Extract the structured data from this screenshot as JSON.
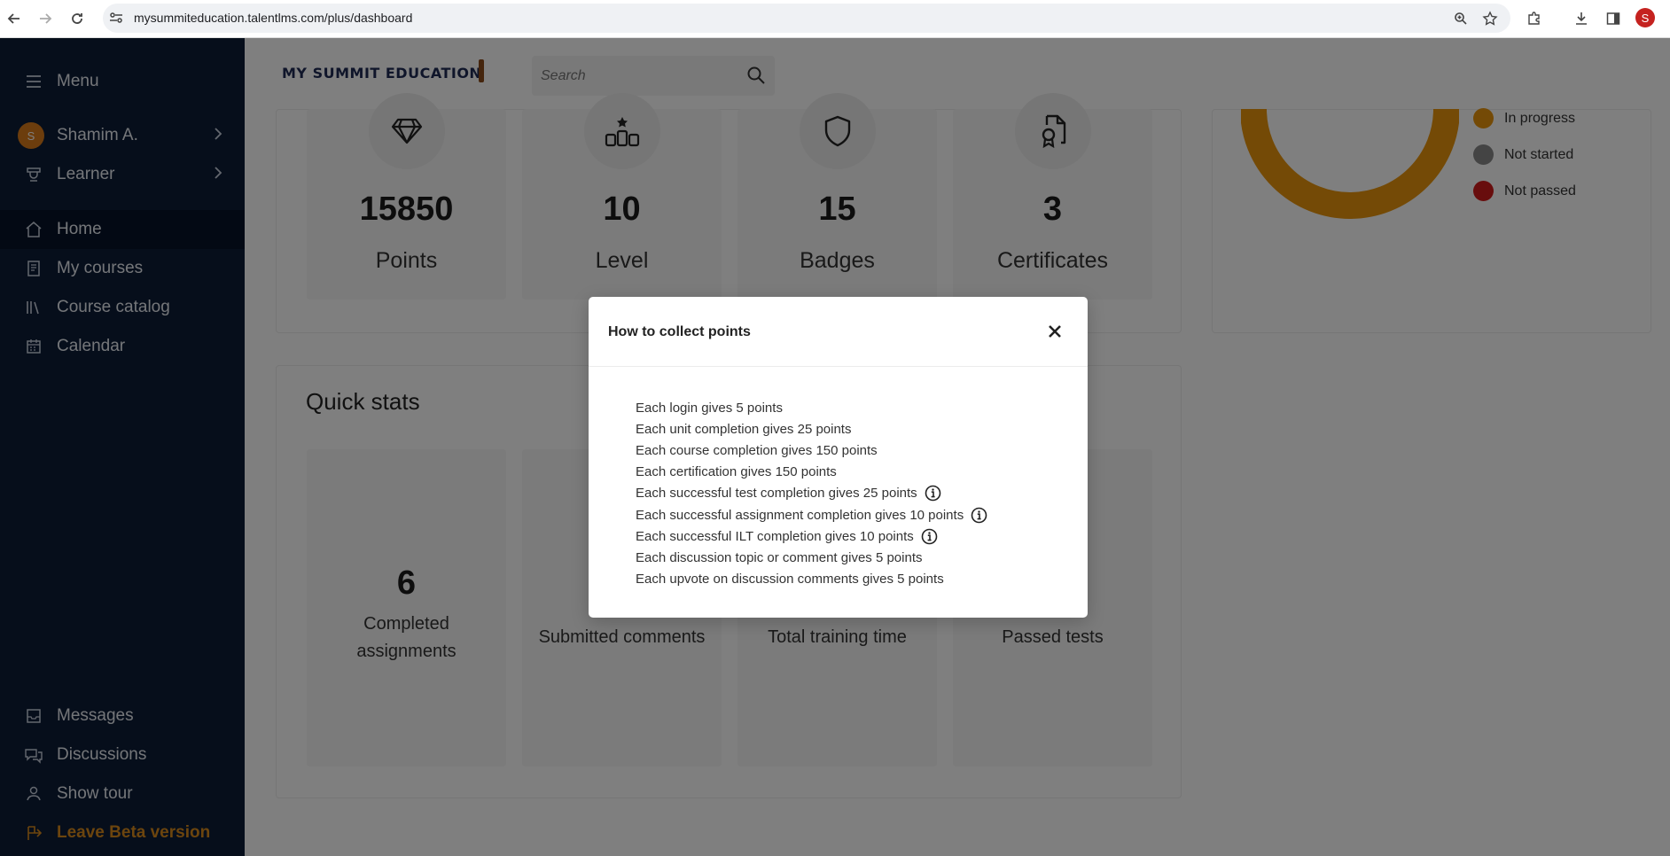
{
  "browser": {
    "url": "mysummiteducation.talentlms.com/plus/dashboard",
    "profile_initial": "S"
  },
  "sidebar": {
    "menu_label": "Menu",
    "user_name": "Shamim A.",
    "user_initial": "S",
    "role": "Learner",
    "items": [
      {
        "label": "Home",
        "icon": "home-icon"
      },
      {
        "label": "My courses",
        "icon": "book-icon"
      },
      {
        "label": "Course catalog",
        "icon": "catalog-icon"
      },
      {
        "label": "Calendar",
        "icon": "calendar-icon"
      }
    ],
    "bottom_items": [
      {
        "label": "Messages",
        "icon": "messages-icon"
      },
      {
        "label": "Discussions",
        "icon": "discussions-icon"
      },
      {
        "label": "Show tour",
        "icon": "tour-icon"
      },
      {
        "label": "Leave Beta version",
        "icon": "beta-icon"
      }
    ]
  },
  "header": {
    "logo": "MY SUMMIT EDUCATION",
    "search_placeholder": "Search"
  },
  "stats": [
    {
      "value": "15850",
      "label": "Points",
      "icon": "diamond-icon"
    },
    {
      "value": "10",
      "label": "Level",
      "icon": "podium-icon"
    },
    {
      "value": "15",
      "label": "Badges",
      "icon": "shield-icon"
    },
    {
      "value": "3",
      "label": "Certificates",
      "icon": "certificate-icon"
    }
  ],
  "progress_legend": [
    {
      "label": "In progress",
      "color": "#e8940c"
    },
    {
      "label": "Not started",
      "color": "#888888"
    },
    {
      "label": "Not passed",
      "color": "#d11a1a"
    }
  ],
  "quick_stats": {
    "title": "Quick stats",
    "tiles": [
      {
        "value": "6",
        "label": "Completed assignments"
      },
      {
        "value": "",
        "label": "Submitted comments"
      },
      {
        "value": "",
        "label": "Total training time"
      },
      {
        "value": "",
        "label": "Passed tests"
      }
    ]
  },
  "modal": {
    "title": "How to collect points",
    "rules": [
      {
        "text": "Each login gives 5 points",
        "info": false
      },
      {
        "text": "Each unit completion gives 25 points",
        "info": false
      },
      {
        "text": "Each course completion gives 150 points",
        "info": false
      },
      {
        "text": "Each certification gives 150 points",
        "info": false
      },
      {
        "text": "Each successful test completion gives 25 points",
        "info": true
      },
      {
        "text": "Each successful assignment completion gives 10 points",
        "info": true
      },
      {
        "text": "Each successful ILT completion gives 10 points",
        "info": true
      },
      {
        "text": "Each discussion topic or comment gives 5 points",
        "info": false
      },
      {
        "text": "Each upvote on discussion comments gives 5 points",
        "info": false
      }
    ]
  }
}
